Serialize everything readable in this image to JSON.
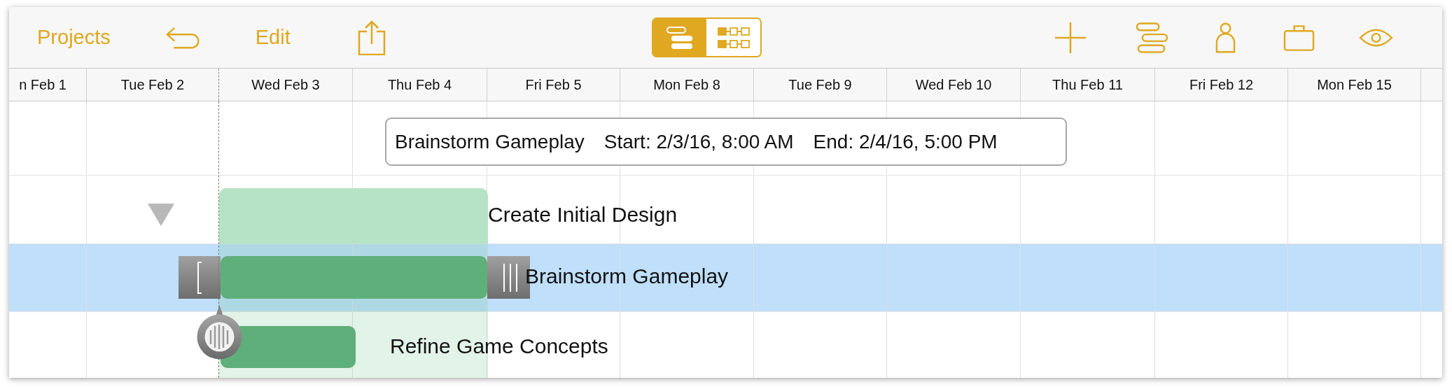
{
  "toolbar": {
    "left": [
      {
        "kind": "text",
        "label": "Projects"
      },
      {
        "kind": "undo"
      },
      {
        "kind": "text",
        "label": "Edit"
      },
      {
        "kind": "share"
      }
    ],
    "view_switch": [
      {
        "kind": "gantt",
        "selected": true
      },
      {
        "kind": "network",
        "selected": false
      }
    ],
    "right": [
      {
        "kind": "add"
      },
      {
        "kind": "task"
      },
      {
        "kind": "person"
      },
      {
        "kind": "briefcase"
      },
      {
        "kind": "eye"
      }
    ]
  },
  "timeline": {
    "columns": [
      "n Feb 1",
      "Tue Feb 2",
      "Wed Feb 3",
      "Thu Feb 4",
      "Fri Feb 5",
      "Mon Feb 8",
      "Tue Feb 9",
      "Wed Feb 10",
      "Thu Feb 11",
      "Fri Feb 12",
      "Mon Feb 15"
    ]
  },
  "tooltip": {
    "task": "Brainstorm Gameplay",
    "start": "Start: 2/3/16, 8:00 AM",
    "end": "End: 2/4/16, 5:00 PM"
  },
  "tasks": [
    {
      "kind": "group",
      "label": "Create Initial Design",
      "expanded": true,
      "selected": false
    },
    {
      "kind": "task",
      "label": "Brainstorm Gameplay",
      "selected": true
    },
    {
      "kind": "task",
      "label": "Refine Game Concepts",
      "selected": false
    }
  ]
}
